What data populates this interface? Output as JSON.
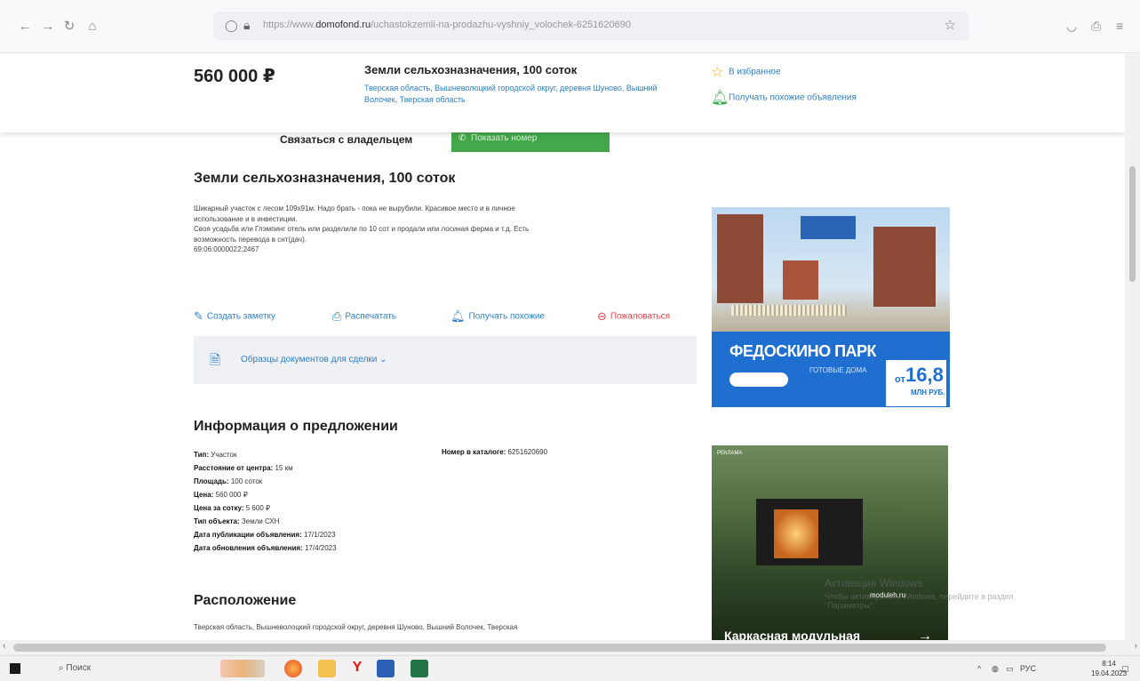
{
  "browser": {
    "url_prefix": "https://www.",
    "url_domain": "domofond.ru",
    "url_path": "/uchastokzemli-na-prodazhu-vyshniy_volochek-6251620690"
  },
  "sticky": {
    "price": "560 000 ₽",
    "title": "Земли сельхозназначения, 100 соток",
    "address": "Тверская область, Вышневолоцкий городской округ, деревня Шуново, Вышний Волочек, Тверская область",
    "favorites": "В избранное",
    "similar": "Получать похожие объявления"
  },
  "contact": {
    "label": "Связаться с владельцем",
    "show_phone": "Показать номер"
  },
  "listing": {
    "title": "Земли сельхозназначения, 100 соток",
    "description": [
      "Шикарный участок с лесом 109х91м. Надо брать - пока не вырубили. Красивое место и в личное",
      "использование и в инвестиции.",
      "Своя усадьба или Глэмпинг отель или разделили по 10 сот и продали или лосиная ферма и т.д. Есть",
      "возможность перевода в снт(дач).",
      "69:06:0000022:2467"
    ],
    "actions": {
      "note": "Создать заметку",
      "print": "Распечатать",
      "similar": "Получать похожие",
      "report": "Пожаловаться"
    },
    "docs_label": "Образцы документов для сделки"
  },
  "info": {
    "heading": "Информация о предложении",
    "rows": [
      {
        "label": "Тип:",
        "value": "Участок"
      },
      {
        "label": "Расстояние от центра:",
        "value": "15 км"
      },
      {
        "label": "Площадь:",
        "value": "100 соток"
      },
      {
        "label": "Цена:",
        "value": "560 000 ₽"
      },
      {
        "label": "Цена за сотку:",
        "value": "5 600 ₽"
      },
      {
        "label": "Тип объекта:",
        "value": "Земли СХН"
      },
      {
        "label": "Дата публикации объявления:",
        "value": "17/1/2023"
      },
      {
        "label": "Дата обновления объявления:",
        "value": "17/4/2023"
      }
    ],
    "catalog_label": "Номер в каталоге:",
    "catalog_value": "6251620690"
  },
  "location": {
    "heading": "Расположение",
    "text": "Тверская область, Вышневолоцкий городской округ, деревня Шуново, Вышний Волочек, Тверская"
  },
  "ads": {
    "ad1": {
      "brand": "ФЕДОСКИНО ПАРК",
      "sub": "ГОТОВЫЕ ДОМА",
      "price_from": "от",
      "price": "16,8",
      "price_unit": "МЛН РУБ."
    },
    "ad2": {
      "badge": "РЕКЛАМА",
      "logo": "moduleh.ru",
      "title": "Каркасная модульная"
    }
  },
  "watermark": {
    "line1": "Активация Windows",
    "line2": "Чтобы активировать Windows, перейдите в раздел",
    "line3": "\"Параметры\"."
  },
  "taskbar": {
    "search": "Поиск",
    "lang": "РУС",
    "time": "8:14",
    "date": "19.04.2023"
  }
}
